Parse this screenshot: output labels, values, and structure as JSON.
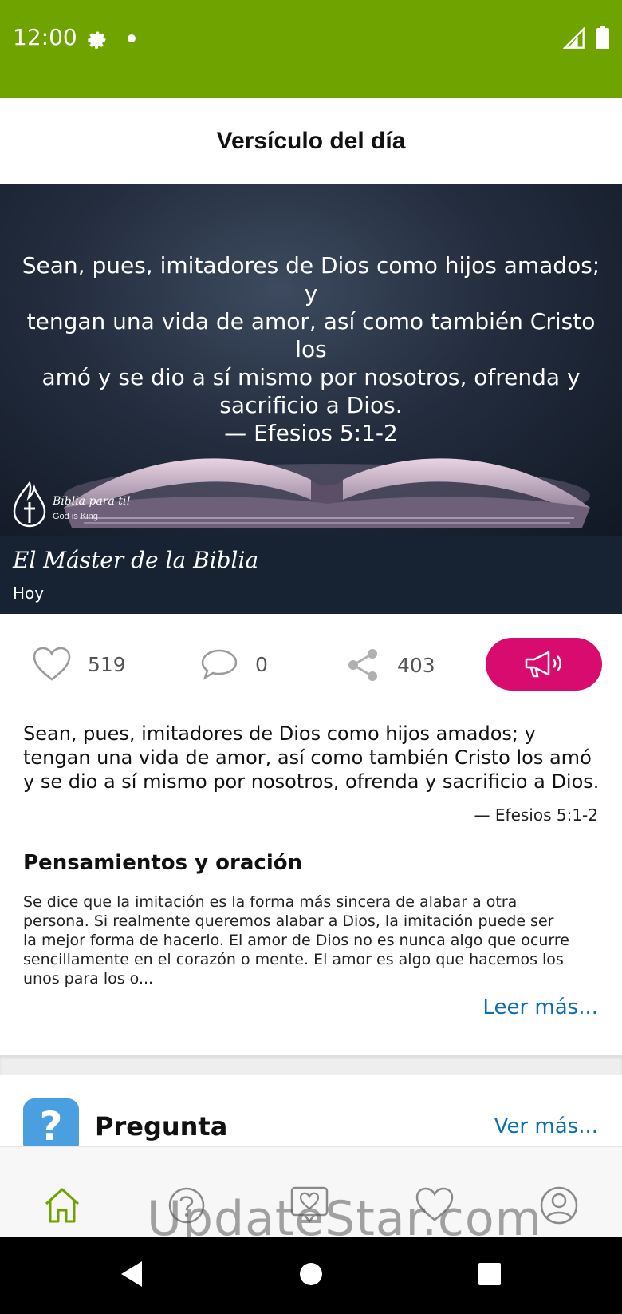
{
  "status_bar": {
    "time": "12:00",
    "icons": [
      "gear-icon",
      "notification-dot-icon",
      "signal-icon",
      "battery-icon"
    ],
    "background": "#6fa300"
  },
  "header": {
    "title": "Versículo del día"
  },
  "hero": {
    "verse_lines": [
      "Sean, pues, imitadores de Dios como hijos amados; y",
      "tengan una vida de amor, así como también Cristo los",
      "amó y se dio a sí mismo por nosotros, ofrenda y",
      "sacrificio a Dios."
    ],
    "reference": "— Efesios 5:1-2",
    "brand_name": "Biblia para ti!",
    "brand_tagline": "God is King"
  },
  "caption": {
    "title": "El Máster de la Biblia",
    "subtitle": "Hoy"
  },
  "actions": {
    "likes": "519",
    "comments": "0",
    "shares": "403",
    "accent_color": "#d80c6f"
  },
  "verse": {
    "lines": [
      "Sean, pues, imitadores de Dios como hijos amados; y",
      "tengan una vida de amor, así como también Cristo los amó",
      "y se dio a sí mismo por nosotros, ofrenda y sacrificio a Dios."
    ],
    "reference": "— Efesios 5:1-2"
  },
  "reflection": {
    "heading": "Pensamientos y oración",
    "lines": [
      "Se dice que la imitación es la forma más sincera de alabar a otra",
      "persona. Si realmente queremos alabar a Dios, la imitación puede ser",
      "la mejor forma de hacerlo. El amor de Dios no es nunca algo que ocurre",
      "sencillamente en el corazón o mente. El amor es algo que hacemos los",
      "unos para los o..."
    ],
    "read_more": "Leer más..."
  },
  "question_card": {
    "icon_glyph": "?",
    "title": "Pregunta",
    "see_more": "Ver más..."
  },
  "bottom_nav": {
    "items": [
      "home-icon",
      "question-icon",
      "prayer-icon",
      "heart-icon",
      "profile-icon"
    ],
    "active": "home-icon",
    "active_color": "#6fa300"
  },
  "watermark": "UpdateStar.com",
  "system_nav": [
    "back-icon",
    "home-circle-icon",
    "recents-icon"
  ]
}
